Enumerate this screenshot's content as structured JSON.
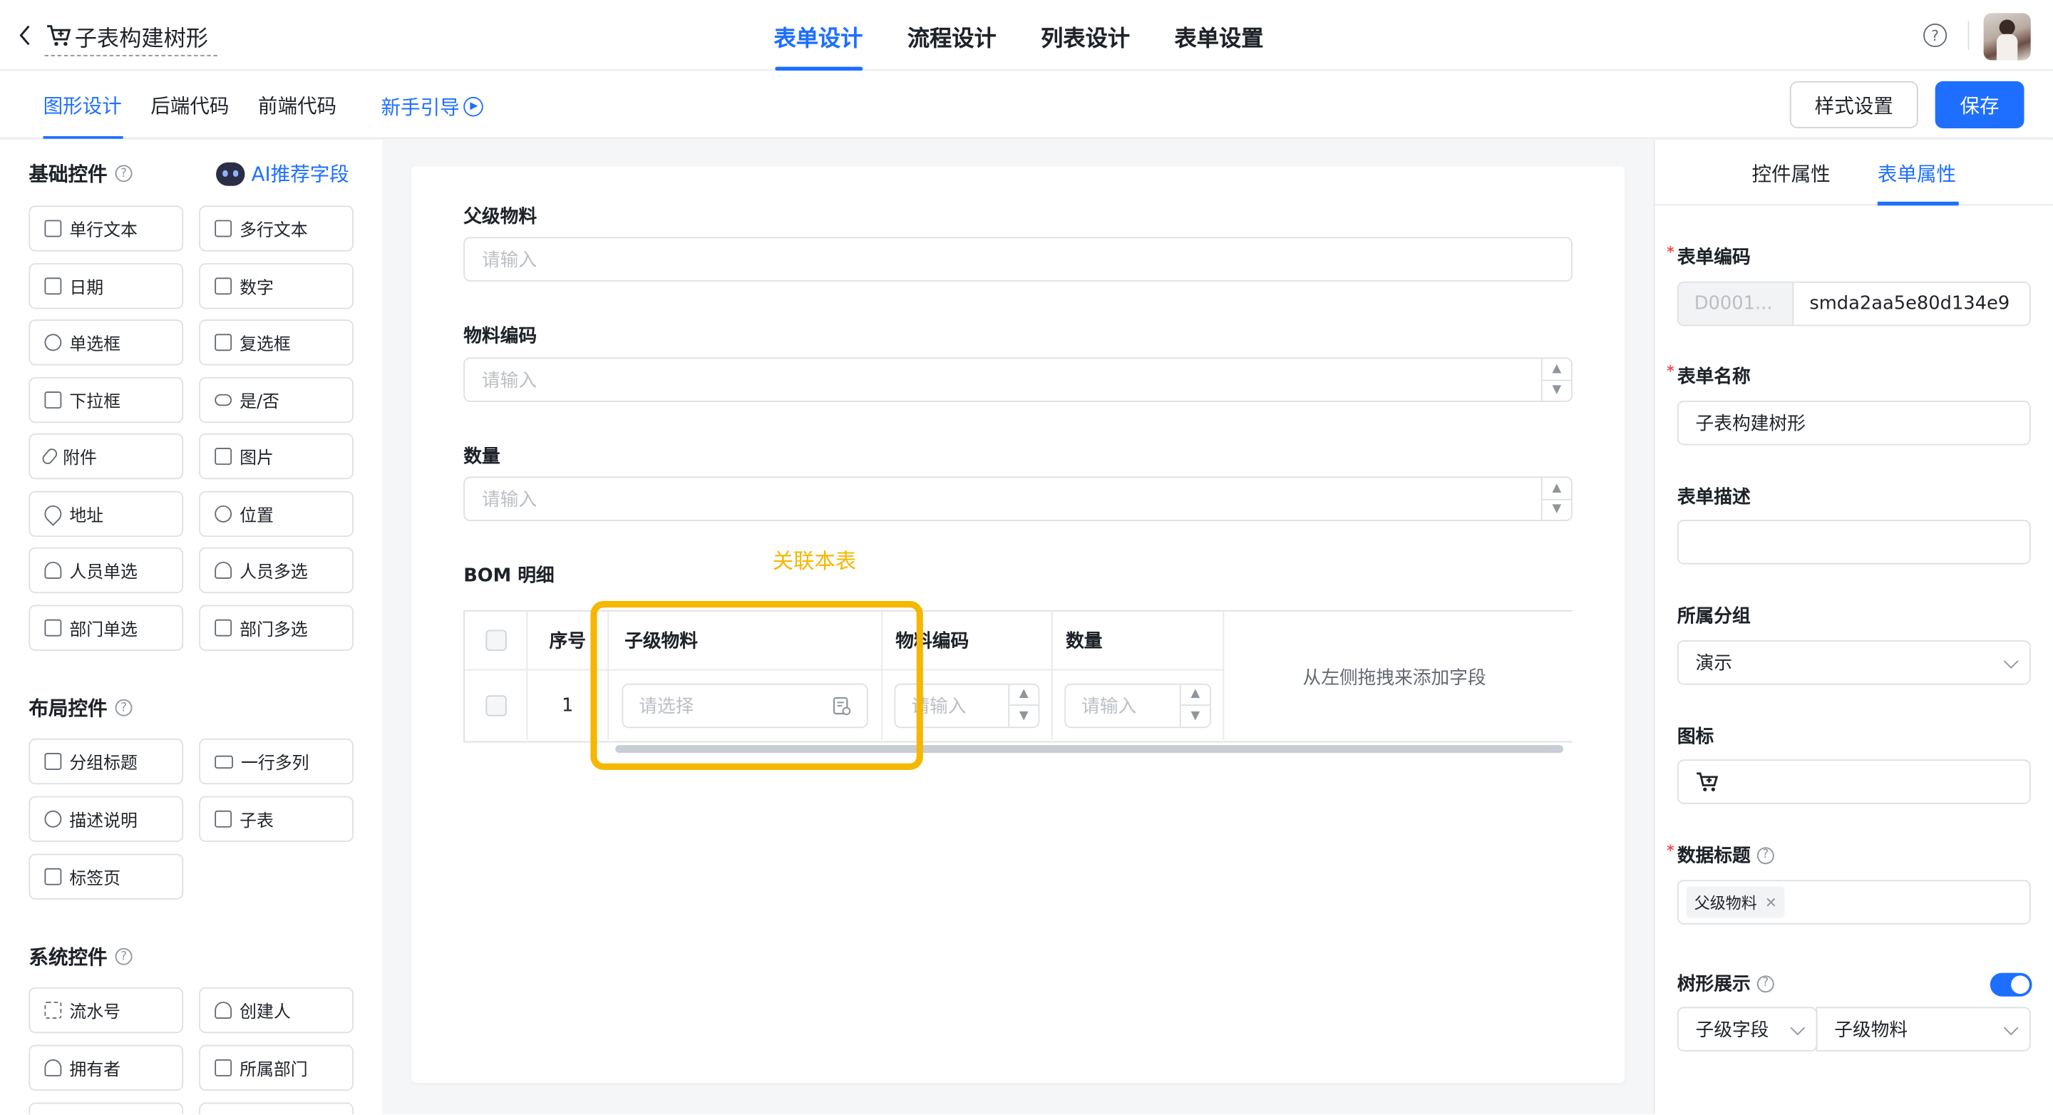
{
  "header": {
    "title": "子表构建树形",
    "tabs": [
      {
        "label": "表单设计",
        "active": true
      },
      {
        "label": "流程设计",
        "active": false
      },
      {
        "label": "列表设计",
        "active": false
      },
      {
        "label": "表单设置",
        "active": false
      }
    ],
    "help_icon": "question-circle-icon",
    "avatar_icon": "user-avatar"
  },
  "subbar": {
    "tabs": [
      {
        "label": "图形设计",
        "active": true
      },
      {
        "label": "后端代码",
        "active": false
      },
      {
        "label": "前端代码",
        "active": false
      }
    ],
    "guide_label": "新手引导",
    "style_button": "样式设置",
    "save_button": "保存"
  },
  "left_panel": {
    "basic": {
      "title": "基础控件",
      "ai_label": "AI推荐字段",
      "items": [
        "单行文本",
        "多行文本",
        "日期",
        "数字",
        "单选框",
        "复选框",
        "下拉框",
        "是/否",
        "附件",
        "图片",
        "地址",
        "位置",
        "人员单选",
        "人员多选",
        "部门单选",
        "部门多选"
      ]
    },
    "layout": {
      "title": "布局控件",
      "items": [
        "分组标题",
        "一行多列",
        "描述说明",
        "子表",
        "标签页"
      ]
    },
    "system": {
      "title": "系统控件",
      "items": [
        "流水号",
        "创建人",
        "拥有者",
        "所属部门"
      ]
    }
  },
  "canvas": {
    "fields": [
      {
        "label": "父级物料",
        "placeholder": "请输入"
      },
      {
        "label": "物料编码",
        "placeholder": "请输入"
      },
      {
        "label": "数量",
        "placeholder": "请输入"
      }
    ],
    "annotation": "关联本表",
    "subtable": {
      "label": "BOM 明细",
      "columns": [
        "序号",
        "子级物料",
        "物料编码",
        "数量"
      ],
      "row_index": "1",
      "select_placeholder": "请选择",
      "input_placeholder": "请输入",
      "drop_hint": "从左侧拖拽来添加字段"
    }
  },
  "right_panel": {
    "tabs": [
      {
        "label": "控件属性",
        "active": false
      },
      {
        "label": "表单属性",
        "active": true
      }
    ],
    "form_code_label": "表单编码",
    "form_code_prefix": "D0001...",
    "form_code_value": "smda2aa5e80d134e9",
    "form_name_label": "表单名称",
    "form_name_value": "子表构建树形",
    "form_desc_label": "表单描述",
    "form_desc_value": "",
    "group_label": "所属分组",
    "group_value": "演示",
    "icon_label": "图标",
    "icon_name": "cart-icon",
    "data_title_label": "数据标题",
    "data_title_tag": "父级物料",
    "tree_label": "树形展示",
    "tree_enabled": true,
    "child_field_value": "子级字段",
    "child_material_value": "子级物料"
  },
  "colors": {
    "primary": "#1e6fff",
    "annotation": "#f5b700",
    "required": "#f54a45"
  }
}
